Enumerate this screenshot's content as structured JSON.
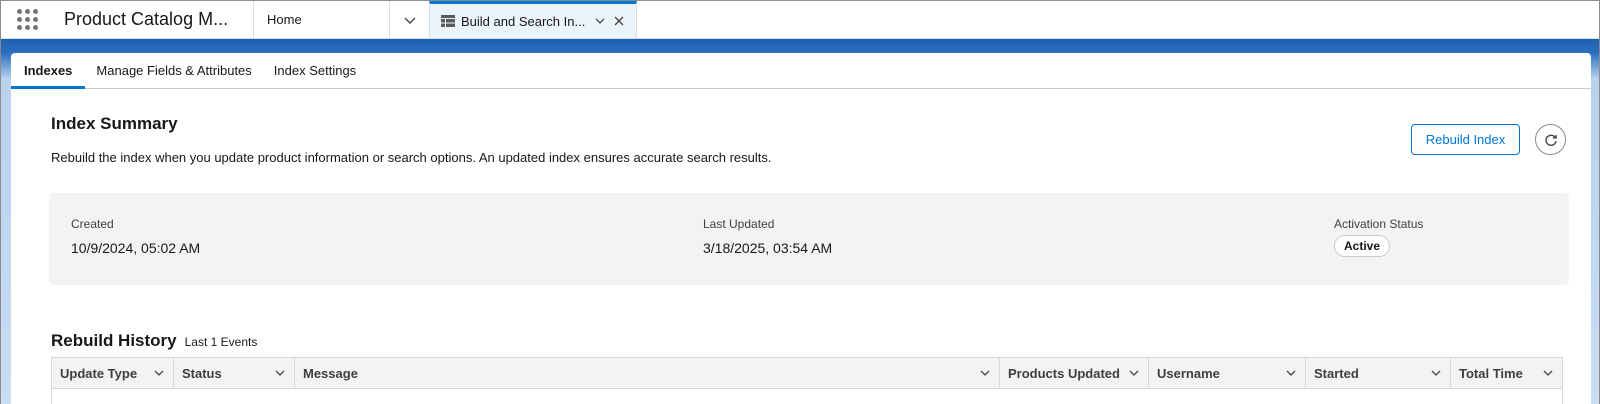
{
  "topnav": {
    "app_name": "Product Catalog M...",
    "home_label": "Home",
    "active_tab_label": "Build and Search In..."
  },
  "subtabs": [
    {
      "label": "Indexes",
      "active": true
    },
    {
      "label": "Manage Fields & Attributes",
      "active": false
    },
    {
      "label": "Index Settings",
      "active": false
    }
  ],
  "summary": {
    "title": "Index Summary",
    "description": "Rebuild the index when you update product information or search options. An updated index ensures accurate search results.",
    "rebuild_button": "Rebuild Index",
    "refresh_icon": "refresh-icon"
  },
  "info": {
    "created_label": "Created",
    "created_value": "10/9/2024, 05:02 AM",
    "updated_label": "Last Updated",
    "updated_value": "3/18/2025, 03:54 AM",
    "status_label": "Activation Status",
    "status_value": "Active"
  },
  "history": {
    "title": "Rebuild History",
    "count": "Last 1 Events",
    "columns": [
      "Update Type",
      "Status",
      "Message",
      "Products Updated",
      "Username",
      "Started",
      "Total Time"
    ]
  },
  "colors": {
    "brand_blue": "#0176d3",
    "panel_gray": "#f3f3f3"
  }
}
